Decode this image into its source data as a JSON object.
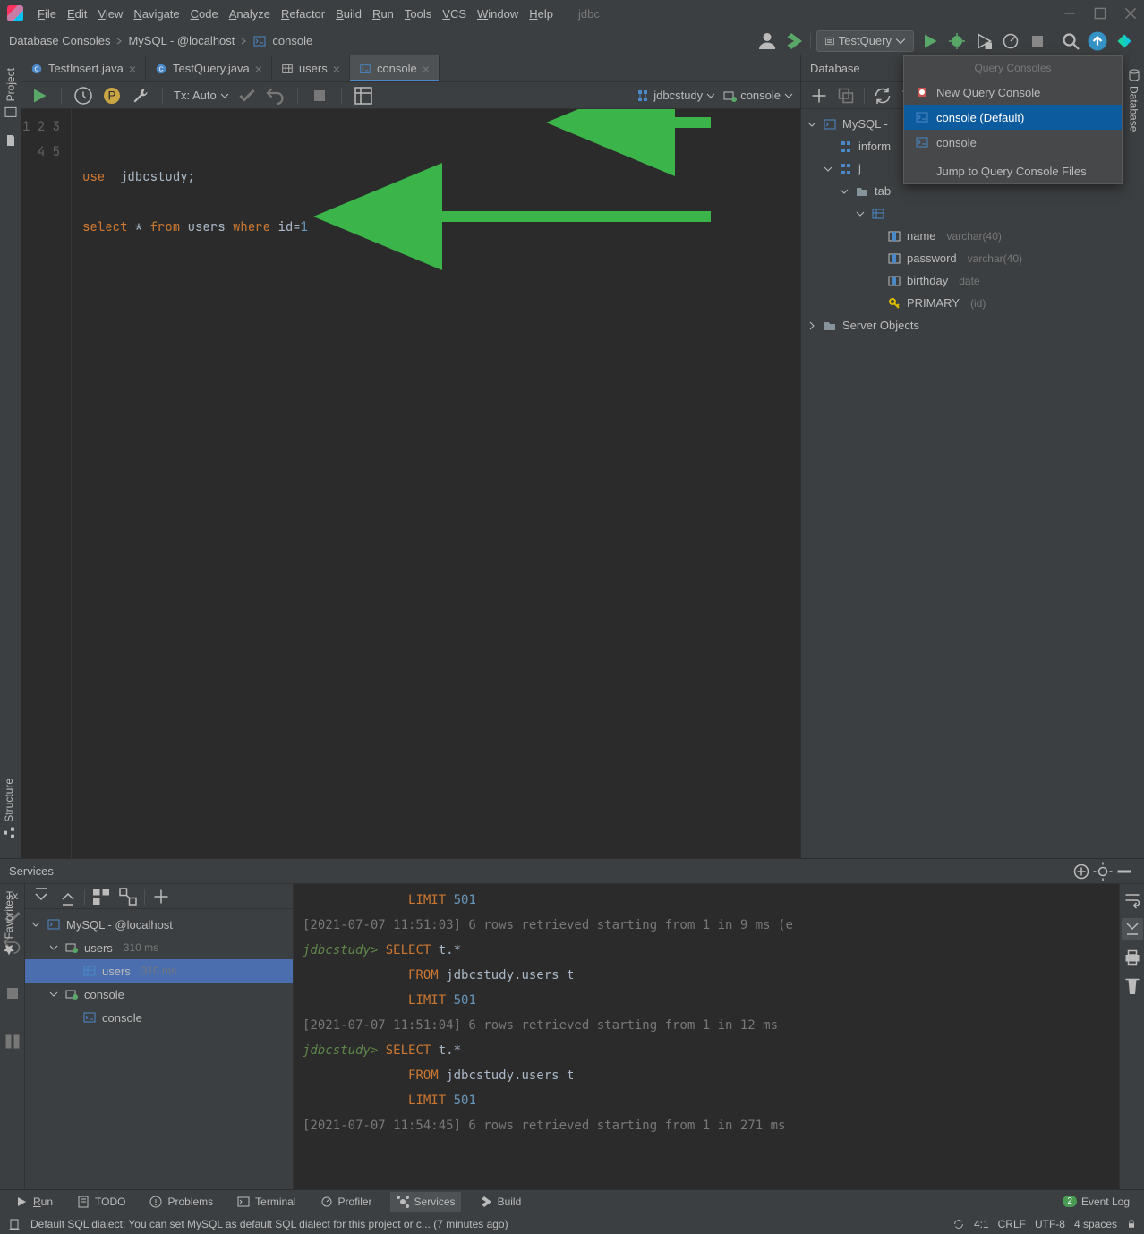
{
  "title": "jdbc",
  "menubar": [
    "File",
    "Edit",
    "View",
    "Navigate",
    "Code",
    "Analyze",
    "Refactor",
    "Build",
    "Run",
    "Tools",
    "VCS",
    "Window",
    "Help"
  ],
  "breadcrumbs": [
    "Database Consoles",
    "MySQL - @localhost",
    "console"
  ],
  "run_config": "TestQuery",
  "editor_tabs": [
    {
      "label": "TestInsert.java",
      "icon": "java",
      "active": false
    },
    {
      "label": "TestQuery.java",
      "icon": "java",
      "active": false
    },
    {
      "label": "users",
      "icon": "table",
      "active": false
    },
    {
      "label": "console",
      "icon": "console",
      "active": true
    }
  ],
  "tx_mode": "Tx: Auto",
  "schema": "jdbcstudy",
  "console": "console",
  "code_lines": [
    {
      "n": 1,
      "html": ""
    },
    {
      "n": 2,
      "html": ""
    },
    {
      "n": 3,
      "html": "<span class='kw'>use</span>  <span class='ident'>jdbcstudy</span>;"
    },
    {
      "n": 4,
      "html": ""
    },
    {
      "n": 5,
      "html": "<span class='kw'>select</span> * <span class='kw'>from</span> <span class='ident'>users</span> <span class='kw'>where</span> <span class='ident'>id</span>=<span class='num'>1</span>"
    }
  ],
  "gutter_left": {
    "project": "Project"
  },
  "gutter_right": {
    "database": "Database"
  },
  "db_panel": {
    "title": "Database",
    "tree": [
      {
        "indent": 0,
        "chev": "down",
        "icon": "db",
        "label": "MySQL -"
      },
      {
        "indent": 1,
        "chev": "",
        "icon": "schema",
        "label": "inform"
      },
      {
        "indent": 1,
        "chev": "down",
        "icon": "schema",
        "label": "j"
      },
      {
        "indent": 2,
        "chev": "down",
        "icon": "folder",
        "label": "tab"
      },
      {
        "indent": 3,
        "chev": "down",
        "icon": "table",
        "label": ""
      },
      {
        "indent": 4,
        "chev": "",
        "icon": "col",
        "label": "name",
        "meta": "varchar(40)"
      },
      {
        "indent": 4,
        "chev": "",
        "icon": "col",
        "label": "password",
        "meta": "varchar(40)"
      },
      {
        "indent": 4,
        "chev": "",
        "icon": "col",
        "label": "birthday",
        "meta": "date"
      },
      {
        "indent": 4,
        "chev": "",
        "icon": "key",
        "label": "PRIMARY",
        "meta": "(id)"
      },
      {
        "indent": 0,
        "chev": "right",
        "icon": "folder",
        "label": "Server Objects"
      }
    ]
  },
  "popup": {
    "title": "Query Consoles",
    "items": [
      {
        "icon": "new",
        "label": "New Query Console"
      },
      {
        "icon": "console",
        "label": "console (Default)",
        "sel": true
      },
      {
        "icon": "console",
        "label": "console"
      },
      {
        "label": "Jump to Query Console Files",
        "sep_before": true
      }
    ]
  },
  "services": {
    "title": "Services",
    "tx_label": "Tx",
    "tree": [
      {
        "indent": 0,
        "chev": "down",
        "icon": "db",
        "label": "MySQL - @localhost"
      },
      {
        "indent": 1,
        "chev": "down",
        "icon": "session",
        "label": "users",
        "meta": "310 ms"
      },
      {
        "indent": 2,
        "chev": "",
        "icon": "table",
        "label": "users",
        "meta": "310 ms",
        "sel": true
      },
      {
        "indent": 1,
        "chev": "down",
        "icon": "session",
        "label": "console"
      },
      {
        "indent": 2,
        "chev": "",
        "icon": "console",
        "label": "console"
      }
    ],
    "output": [
      {
        "type": "sql",
        "indent": 14,
        "text": "LIMIT 501"
      },
      {
        "type": "ts",
        "text": "[2021-07-07 11:51:03] 6 rows retrieved starting from 1 in 9 ms (e"
      },
      {
        "type": "prompt",
        "db": "jdbcstudy",
        "sql": "SELECT t.*"
      },
      {
        "type": "sql",
        "indent": 14,
        "text": "FROM jdbcstudy.users t"
      },
      {
        "type": "sql",
        "indent": 14,
        "text": "LIMIT 501"
      },
      {
        "type": "ts",
        "text": "[2021-07-07 11:51:04] 6 rows retrieved starting from 1 in 12 ms "
      },
      {
        "type": "prompt",
        "db": "jdbcstudy",
        "sql": "SELECT t.*"
      },
      {
        "type": "sql",
        "indent": 14,
        "text": "FROM jdbcstudy.users t"
      },
      {
        "type": "sql",
        "indent": 14,
        "text": "LIMIT 501"
      },
      {
        "type": "ts",
        "text": "[2021-07-07 11:54:45] 6 rows retrieved starting from 1 in 271 ms"
      }
    ]
  },
  "bottom_tabs": [
    {
      "icon": "run",
      "label": "Run",
      "accel": "R"
    },
    {
      "icon": "todo",
      "label": "TODO"
    },
    {
      "icon": "problems",
      "label": "Problems"
    },
    {
      "icon": "terminal",
      "label": "Terminal"
    },
    {
      "icon": "profiler",
      "label": "Profiler"
    },
    {
      "icon": "services",
      "label": "Services",
      "active": true
    },
    {
      "icon": "build",
      "label": "Build"
    }
  ],
  "event_log": {
    "badge": "2",
    "label": "Event Log"
  },
  "status": {
    "msg": "Default SQL dialect: You can set MySQL as default SQL dialect for this project or c... (7 minutes ago)",
    "pos": "4:1",
    "eol": "CRLF",
    "enc": "UTF-8",
    "indent": "4 spaces"
  },
  "side_tabs": {
    "structure": "Structure",
    "favorites": "Favorites"
  }
}
